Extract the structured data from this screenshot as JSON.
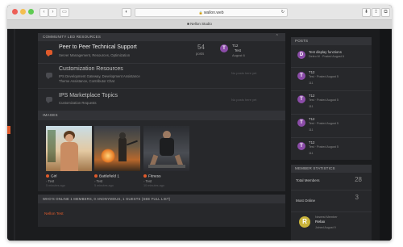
{
  "browser": {
    "url": "wallon.web",
    "tab_title": "■ Nellon Studio"
  },
  "community": {
    "header": "COMMUNITY LED RESOURCES",
    "forums": [
      {
        "title": "Peer to Peer Technical Support",
        "subforums": "Server Management,  Resources, Optimization",
        "posts_count": "54",
        "posts_label": "posts",
        "last_user_initial": "T",
        "last_user_name": "T12",
        "last_post_title": "Test",
        "last_post_date": "August 6"
      },
      {
        "title": "Customization Resources",
        "subforums_line1": "IPS Development Gateway,   Development Assistance",
        "subforums_line2": "Theme Assistance,   Contributor Chat",
        "no_posts": "No posts here yet"
      },
      {
        "title": "IPS Marketplace Topics",
        "subforums": "Customization Requests",
        "no_posts": "No posts here yet"
      }
    ]
  },
  "images": {
    "header": "IMAGES",
    "items": [
      {
        "title": "Girl",
        "author": "Test",
        "time": "5 minutes ago"
      },
      {
        "title": "Battlefield 1",
        "author": "Test",
        "time": "5 minutes ago"
      },
      {
        "title": "Fitness",
        "author": "Test",
        "time": "10 minutes ago"
      }
    ]
  },
  "online": {
    "header": "WHO'S ONLINE  1 MEMBERS, 0 ANONYMOUS, 1 GUESTS (SEE FULL LIST)",
    "member": "Nellon Test"
  },
  "posts_sidebar": {
    "header": "POSTS",
    "items": [
      {
        "initial": "D",
        "title": "Test display functions",
        "meta": "Deleo M · Posted August 6",
        "extra": ""
      },
      {
        "initial": "T",
        "title": "T12",
        "meta": "Test · Posted August 5",
        "extra": "111"
      },
      {
        "initial": "T",
        "title": "T12",
        "meta": "Test · Posted August 5",
        "extra": "111"
      },
      {
        "initial": "T",
        "title": "T12",
        "meta": "Test · Posted August 5",
        "extra": "111"
      },
      {
        "initial": "T",
        "title": "T12",
        "meta": "Test · Posted August 5",
        "extra": "111"
      }
    ]
  },
  "stats": {
    "header": "MEMBER STATISTICS",
    "total_label": "Total Members",
    "total_value": "28",
    "online_label": "Most Online",
    "online_value": "3",
    "online_sub": "Newest Member",
    "newest_label": "Newest Member",
    "newest_name": "Relax",
    "newest_initial": "R",
    "newest_date": "Joined August 9"
  },
  "colors": {
    "accent": "#e05a2b",
    "avatar_purple": "#8b4ca8",
    "avatar_yellow": "#c9b33a",
    "background": "#1b1c1e",
    "panel": "#27282b"
  }
}
